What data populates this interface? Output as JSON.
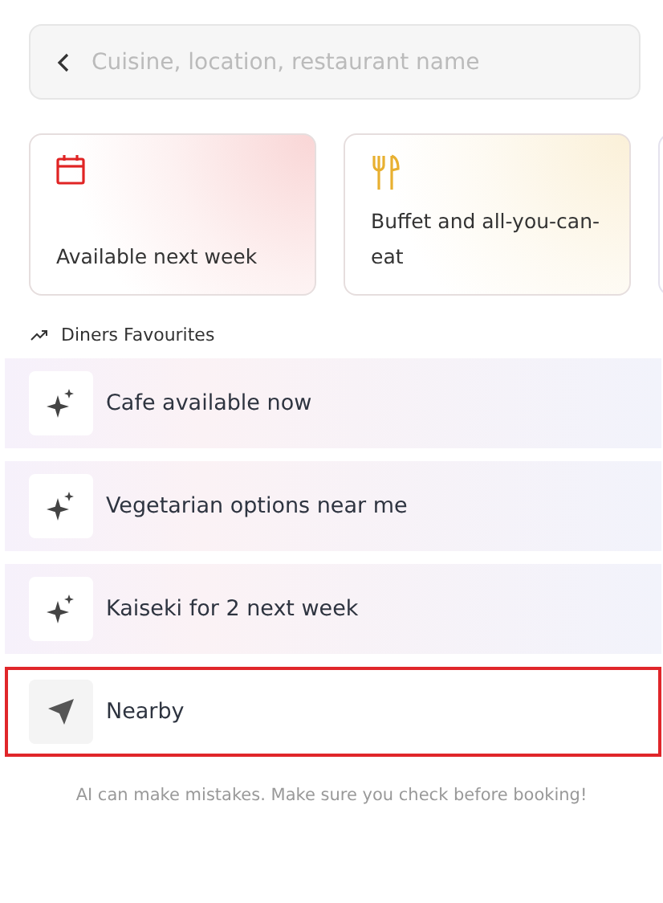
{
  "search": {
    "placeholder": "Cuisine, location, restaurant name"
  },
  "cards": [
    {
      "kind": "calendar",
      "label": "Available next week",
      "color": "#e02424"
    },
    {
      "kind": "cutlery",
      "label": "Buffet and all-you-can-eat",
      "color": "#e8b030"
    }
  ],
  "section": {
    "title": "Diners Favourites"
  },
  "suggestions": [
    {
      "kind": "sparkle",
      "label": "Cafe available now",
      "selected": false
    },
    {
      "kind": "sparkle",
      "label": "Vegetarian options near me",
      "selected": false
    },
    {
      "kind": "sparkle",
      "label": "Kaiseki for 2 next week",
      "selected": false
    },
    {
      "kind": "location",
      "label": "Nearby",
      "selected": true
    }
  ],
  "disclaimer": "AI can make mistakes. Make sure you check before booking!"
}
